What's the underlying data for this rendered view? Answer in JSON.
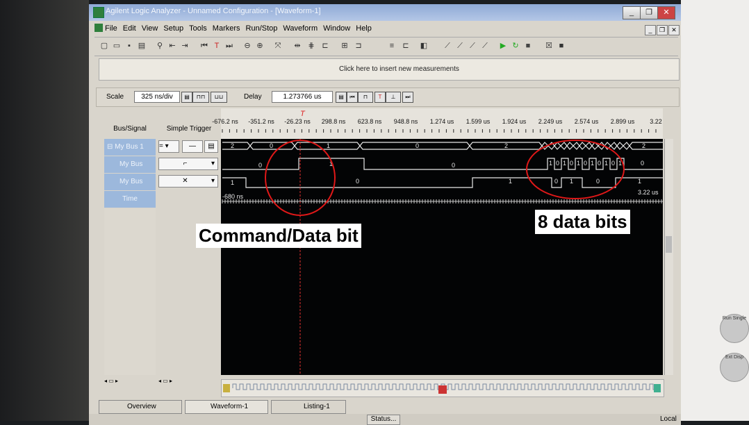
{
  "window": {
    "title": "Agilent Logic Analyzer - Unnamed Configuration - [Waveform-1]",
    "controls": [
      "_",
      "❐",
      "✕"
    ],
    "mdi_controls": [
      "_",
      "❐",
      "✕"
    ]
  },
  "menu": [
    "File",
    "Edit",
    "View",
    "Setup",
    "Tools",
    "Markers",
    "Run/Stop",
    "Waveform",
    "Window",
    "Help"
  ],
  "measurements_bar": {
    "text": "Click here to insert new measurements"
  },
  "scale": {
    "label": "Scale",
    "value": "325 ns/div"
  },
  "delay": {
    "label": "Delay",
    "value": "1.273766 us"
  },
  "columns": {
    "bus_signal": "Bus/Signal",
    "simple_trigger": "Simple Trigger"
  },
  "signals": [
    {
      "name": "My Bus 1",
      "trigger": "=",
      "trigger_value": "—"
    },
    {
      "name": "My Bus",
      "trigger": "⌐"
    },
    {
      "name": "My Bus",
      "trigger": "✕"
    },
    {
      "name": "Time"
    }
  ],
  "time_ruler": [
    "-676.2 ns",
    "-351.2 ns",
    "-26.23 ns",
    "298.8 ns",
    "623.8 ns",
    "948.8 ns",
    "1.274 us",
    "1.599 us",
    "1.924 us",
    "2.249 us",
    "2.574 us",
    "2.899 us",
    "3.22"
  ],
  "trigger_marker": "T",
  "waveforms": {
    "bus1_values": [
      "2",
      "0",
      "1",
      "0",
      "2",
      "2"
    ],
    "bit1_values": [
      "0",
      "1",
      "0",
      "1",
      "0",
      "1",
      "0",
      "1",
      "0",
      "1",
      "0",
      "1",
      "0",
      "1",
      "0"
    ],
    "bit2_values": [
      "1",
      "0",
      "1",
      "0",
      "1",
      "0",
      "1"
    ],
    "time_start": "-680 ns",
    "time_end": "3.22 us"
  },
  "tabs": [
    "Overview",
    "Waveform-1",
    "Listing-1"
  ],
  "status": {
    "button": "Status...",
    "mode": "Local"
  },
  "annotations": {
    "left": "Command/Data bit",
    "right": "8 data bits"
  },
  "bezel": {
    "run_single": "Run Single",
    "extra": "Ext Disp"
  },
  "colors": {
    "waveform": "#e8e8e8",
    "background": "#030405",
    "annotation_circle": "#e01818",
    "marker": "#e03030"
  }
}
